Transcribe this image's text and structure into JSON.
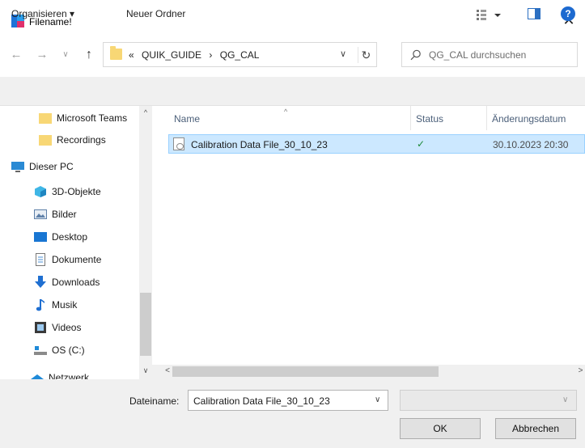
{
  "window": {
    "title": "Filename!",
    "close_glyph": "✕"
  },
  "address": {
    "overflow": "«",
    "crumbs": [
      "QUIK_GUIDE",
      "QG_CAL"
    ],
    "separator": "›"
  },
  "search": {
    "placeholder": "QG_CAL durchsuchen"
  },
  "toolbar": {
    "organize_label": "Organisieren ▾",
    "new_folder_label": "Neuer Ordner",
    "help_label": "?"
  },
  "nav": {
    "items": [
      {
        "label": "Microsoft Teams",
        "icon": "folder-icon"
      },
      {
        "label": "Recordings",
        "icon": "folder-icon"
      },
      {
        "label": "Dieser PC",
        "icon": "computer-icon"
      },
      {
        "label": "3D-Objekte",
        "icon": "3d-objects-icon"
      },
      {
        "label": "Bilder",
        "icon": "pictures-icon"
      },
      {
        "label": "Desktop",
        "icon": "desktop-icon"
      },
      {
        "label": "Dokumente",
        "icon": "documents-icon"
      },
      {
        "label": "Downloads",
        "icon": "download-icon"
      },
      {
        "label": "Musik",
        "icon": "music-icon"
      },
      {
        "label": "Videos",
        "icon": "videos-icon"
      },
      {
        "label": "OS (C:)",
        "icon": "drive-icon"
      },
      {
        "label": "Netzwerk",
        "icon": "network-icon"
      }
    ]
  },
  "file_list": {
    "columns": [
      "Name",
      "Status",
      "Änderungsdatum"
    ],
    "rows": [
      {
        "name": "Calibration Data File_30_10_23",
        "status": "✓",
        "date": "30.10.2023 20:30",
        "selected": true
      }
    ]
  },
  "bottom": {
    "filename_label": "Dateiname:",
    "filename_value": "Calibration Data File_30_10_23",
    "filetype_value": "",
    "ok_label": "OK",
    "cancel_label": "Abbrechen"
  },
  "colors": {
    "selection": "#cce8ff",
    "selection_border": "#99d1ff",
    "help_blue": "#1d6ad0",
    "folder": "#f8d775"
  }
}
